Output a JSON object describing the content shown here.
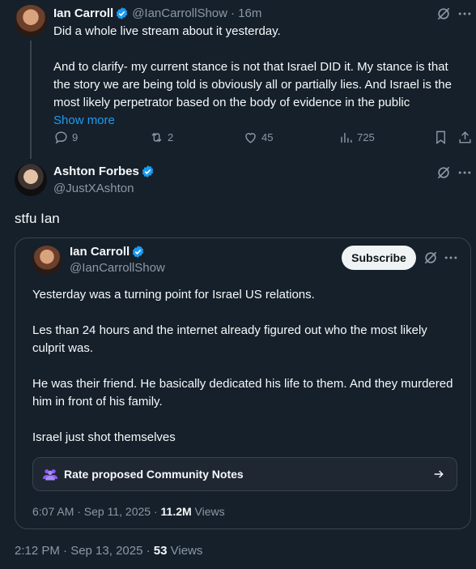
{
  "tweet1": {
    "name": "Ian Carroll",
    "handle": "@IanCarrollShow",
    "time": "· 16m",
    "line1": "Did a whole live stream about it yesterday.",
    "para2": "And to clarify- my current stance is not that Israel DID it. My stance is that the story we are being told is obviously all or partially lies. And Israel is the most likely perpetrator based on the body of evidence in the public",
    "show_more": "Show more",
    "replies": "9",
    "reposts": "2",
    "likes": "45",
    "views": "725"
  },
  "tweet2": {
    "name": "Ashton Forbes",
    "handle": "@JustXAshton",
    "text": "stfu Ian",
    "footer_time": "2:12 PM · Sep 13, 2025 · ",
    "footer_views_count": "53",
    "footer_views_label": " Views"
  },
  "quote": {
    "name": "Ian Carroll",
    "handle": "@IanCarrollShow",
    "subscribe_label": "Subscribe",
    "p1": "Yesterday was a turning point for Israel US relations.",
    "p2": "Les than 24 hours and the internet already figured out who the most likely culprit was.",
    "p3": "He was their friend. He basically dedicated his life to them. And they murdered him in front of his family.",
    "p4": "Israel just shot themselves",
    "community_notes_label": "Rate proposed Community Notes",
    "footer_time": "6:07 AM · Sep 11, 2025 · ",
    "footer_views_count": "11.2M",
    "footer_views_label": " Views"
  },
  "colors": {
    "background": "#15202b",
    "accent": "#1d9bf0",
    "muted": "#8b98a5",
    "border": "#38444d",
    "community_notes": "#8b5cf6"
  },
  "icons": [
    "grok-icon",
    "more-icon",
    "reply-icon",
    "repost-icon",
    "like-icon",
    "views-icon",
    "bookmark-icon",
    "share-icon",
    "verified-badge-icon",
    "community-notes-icon",
    "arrow-right-icon"
  ]
}
